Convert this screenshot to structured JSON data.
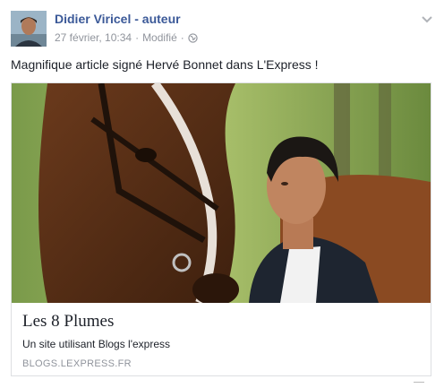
{
  "post": {
    "author": "Didier Viricel - auteur",
    "date": "27 février, 10:34",
    "separator": "·",
    "edited": "Modifié",
    "audience_icon": "globe-icon",
    "menu_icon": "chevron-down-icon",
    "text": "Magnifique article signé Hervé Bonnet dans L'Express !"
  },
  "link_card": {
    "image_icon": "photo-horse-man",
    "title": "Les 8 Plumes",
    "description": "Un site utilisant Blogs l'express",
    "domain": "BLOGS.LEXPRESS.FR"
  },
  "colors": {
    "author_link": "#3b5998",
    "meta_text": "#90949c",
    "body_text": "#1d2129",
    "card_border": "#dddfe2"
  }
}
